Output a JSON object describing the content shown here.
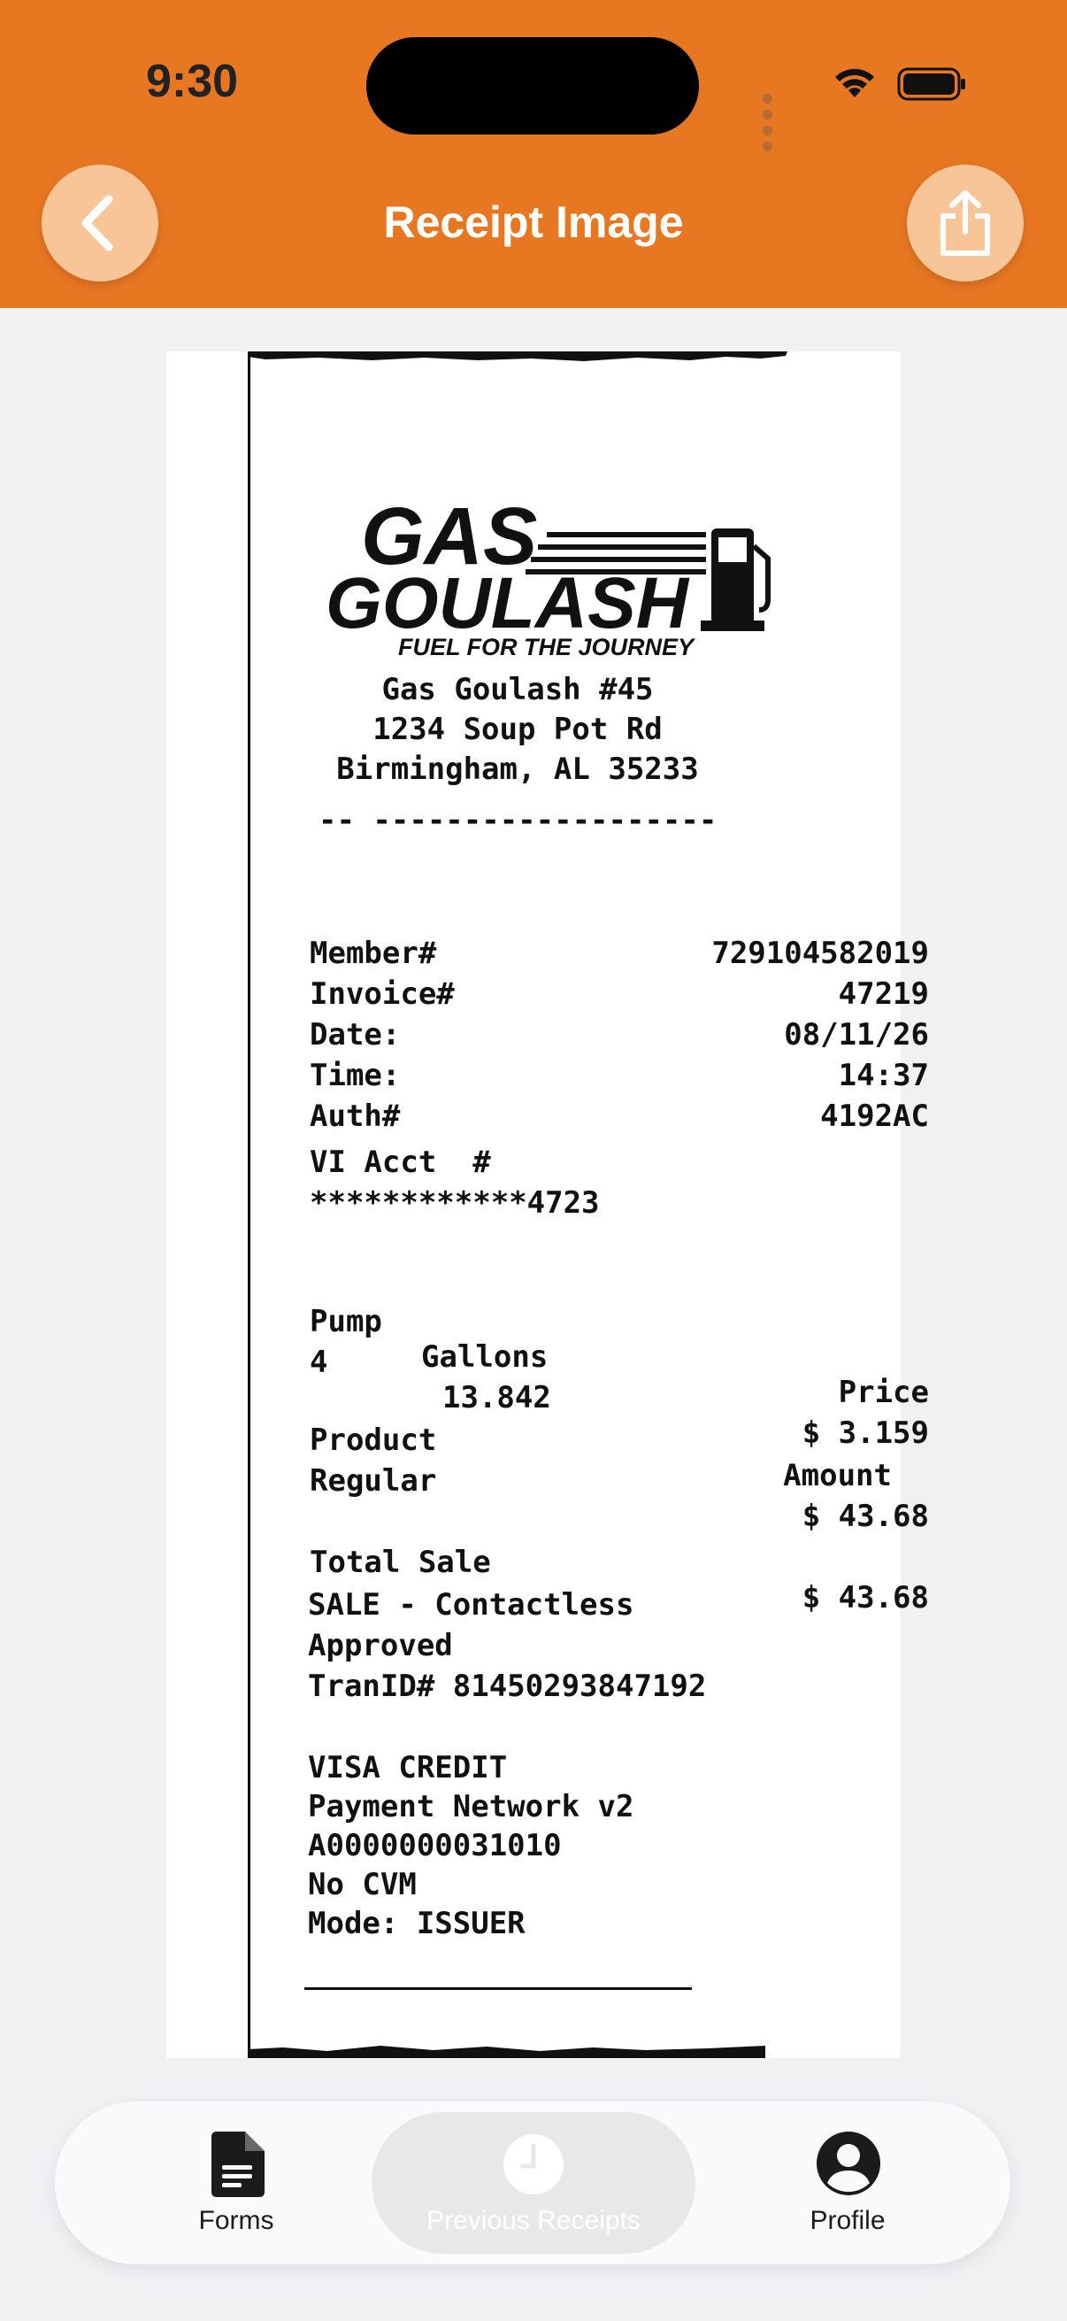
{
  "status_bar": {
    "time": "9:30"
  },
  "header": {
    "title": "Receipt Image"
  },
  "receipt": {
    "brand_line1": "GAS",
    "brand_line2": "GOULASH",
    "tagline": "FUEL FOR THE JOURNEY",
    "store_name": "Gas Goulash #45",
    "address": "1234 Soup Pot Rd",
    "city": "Birmingham, AL 35233",
    "divider": "-- -------------------",
    "fields": [
      {
        "label": "Member#",
        "value": "729104582019"
      },
      {
        "label": "Invoice#",
        "value": "47219"
      },
      {
        "label": "Date:",
        "value": "08/11/26"
      },
      {
        "label": "Time:",
        "value": "14:37"
      },
      {
        "label": "Auth#",
        "value": "4192AC"
      }
    ],
    "acct_label": "VI Acct  #",
    "acct_number": "************4723",
    "pump_header": {
      "pump": "Pump",
      "gallons": "Gallons",
      "price": "Price"
    },
    "pump_row": {
      "pump": "4",
      "gallons": "13.842",
      "price": "$ 3.159"
    },
    "product_header": {
      "product": "Product",
      "amount": "Amount"
    },
    "product_row": {
      "product": "Regular",
      "amount": "$ 43.68"
    },
    "total_label": "Total Sale",
    "total_value": "$ 43.68",
    "sale_lines": [
      "SALE - Contactless",
      "Approved",
      "TranID# 81450293847192"
    ],
    "card_lines": [
      "VISA CREDIT",
      "Payment Network v2",
      "A0000000031010",
      "No CVM",
      "Mode: ISSUER"
    ]
  },
  "tabbar": {
    "tabs": [
      {
        "label": "Forms",
        "icon": "document-icon"
      },
      {
        "label": "Previous Receipts",
        "icon": "clock-icon"
      },
      {
        "label": "Profile",
        "icon": "person-circle-icon"
      }
    ]
  },
  "colors": {
    "brand_orange": "#e87722",
    "button_peach": "#f7c598"
  }
}
